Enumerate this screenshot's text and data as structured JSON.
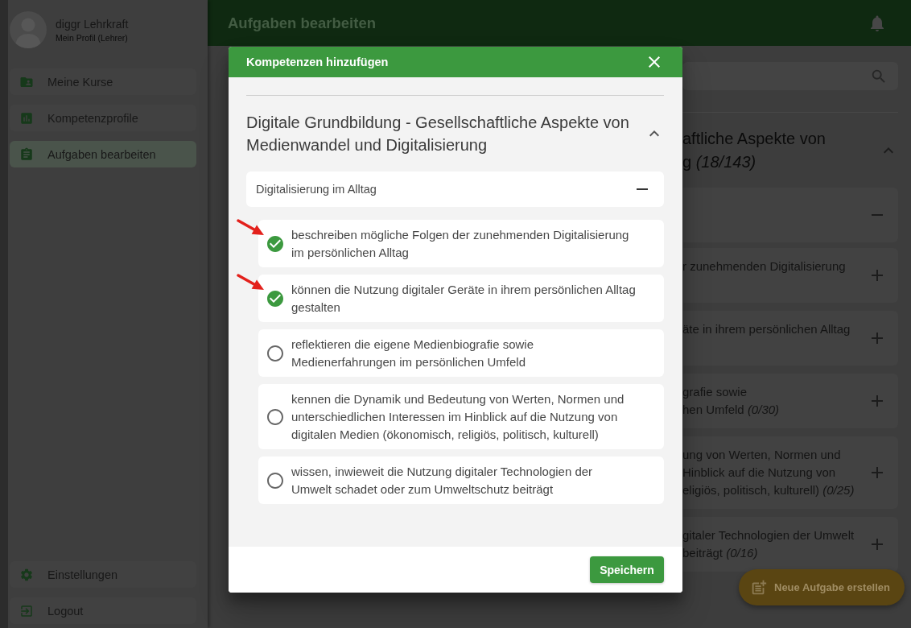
{
  "sidebar": {
    "profile": {
      "name": "diggr Lehrkraft",
      "role": "Mein Profil (Lehrer)"
    },
    "nav_items": [
      {
        "label": "Meine Kurse",
        "selected": false
      },
      {
        "label": "Kompetenzprofile",
        "selected": false
      },
      {
        "label": "Aufgaben bearbeiten",
        "selected": true
      }
    ],
    "bottom_items": [
      {
        "label": "Einstellungen"
      },
      {
        "label": "Logout"
      }
    ]
  },
  "header": {
    "title": "Aufgaben bearbeiten"
  },
  "main": {
    "section": {
      "title_lines": [
        "aftliche Aspekte von",
        "g *(18/143)*"
      ],
      "expanded": true
    },
    "group": {
      "expanded": true
    },
    "competences": [
      {
        "lines": [
          "r zunehmenden Digitalisierung"
        ],
        "expanded": false
      },
      {
        "lines": [
          "äte in ihrem persönlichen Alltag"
        ],
        "expanded": false
      },
      {
        "lines": [
          "grafie sowie",
          "hen Umfeld *(0/30)*"
        ],
        "expanded": false
      },
      {
        "lines": [
          "ung von Werten, Normen und",
          "Hinblick auf die Nutzung von",
          "eligiös, politisch, kulturell) *(0/25)*"
        ],
        "expanded": false
      },
      {
        "lines": [
          "gitaler Technologien der Umwelt",
          "beiträgt *(0/16)*"
        ],
        "expanded": false
      }
    ],
    "fab": {
      "label": "Neue Aufgabe erstellen"
    }
  },
  "dialog": {
    "title": "Kompetenzen hinzufügen",
    "section": {
      "title": "Digitale Grundbildung - Gesellschaftliche Aspekte von Medienwandel und Digitalisierung",
      "expanded": true
    },
    "group": {
      "title": "Digitalisierung im Alltag",
      "expanded": true
    },
    "competences": [
      {
        "lines": [
          "beschreiben mögliche Folgen der zunehmenden Digitalisierung",
          "im persönlichen Alltag"
        ],
        "checked": true,
        "marked": true
      },
      {
        "lines": [
          "können die Nutzung digitaler Geräte in ihrem persönlichen Alltag",
          "gestalten"
        ],
        "checked": true,
        "marked": true
      },
      {
        "lines": [
          "reflektieren die eigene Medienbiografie sowie",
          "Medienerfahrungen im persönlichen Umfeld"
        ],
        "checked": false,
        "marked": false
      },
      {
        "lines": [
          "kennen die Dynamik und Bedeutung von Werten, Normen und",
          "unterschiedlichen Interessen im Hinblick auf die Nutzung von",
          "digitalen Medien (ökonomisch, religiös, politisch, kulturell)"
        ],
        "checked": false,
        "marked": false
      },
      {
        "lines": [
          "wissen, inwieweit die Nutzung digitaler Technologien der",
          "Umwelt schadet oder zum Umweltschutz beiträgt"
        ],
        "checked": false,
        "marked": false
      }
    ],
    "save_button": "Speichern"
  }
}
